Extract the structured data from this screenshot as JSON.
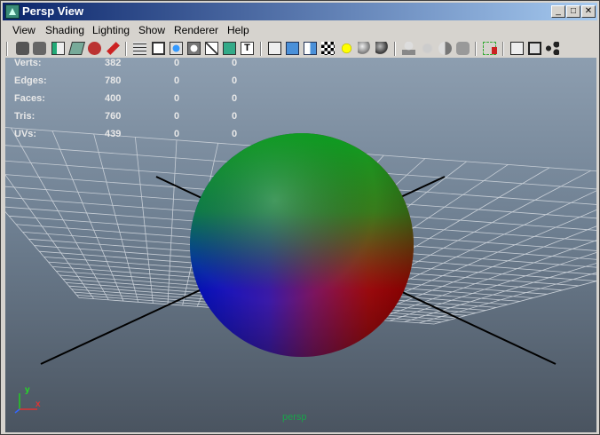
{
  "window": {
    "title": "Persp View",
    "min_glyph": "_",
    "max_glyph": "□",
    "close_glyph": "✕"
  },
  "menu": {
    "items": [
      "View",
      "Shading",
      "Lighting",
      "Show",
      "Renderer",
      "Help"
    ]
  },
  "toolbar": {
    "icons": [
      "camera-icon",
      "camera-attributes-icon",
      "bookmark-icon",
      "image-plane-icon",
      "isolate-icon",
      "pencil-icon",
      "grid-icon",
      "film-gate-icon",
      "resolution-gate-icon",
      "gate-mask-icon",
      "field-chart-icon",
      "safe-action-icon",
      "safe-title-icon",
      "wireframe-cube-icon",
      "smooth-shade-cube-icon",
      "flat-shade-cube-icon",
      "checker-icon",
      "default-light-icon",
      "all-lights-icon",
      "shadow-icon",
      "xray-joints-icon",
      "xray-icon",
      "backface-icon",
      "smooth-preview-icon",
      "high-quality-icon",
      "select-camera-icon",
      "frame-all-icon",
      "isolate-select-icon",
      "hypergraph-icon"
    ]
  },
  "hud": {
    "rows": [
      {
        "label": "Verts:",
        "values": [
          "382",
          "0",
          "0"
        ]
      },
      {
        "label": "Edges:",
        "values": [
          "780",
          "0",
          "0"
        ]
      },
      {
        "label": "Faces:",
        "values": [
          "400",
          "0",
          "0"
        ]
      },
      {
        "label": "Tris:",
        "values": [
          "760",
          "0",
          "0"
        ]
      },
      {
        "label": "UVs:",
        "values": [
          "439",
          "0",
          "0"
        ]
      }
    ]
  },
  "axis": {
    "x": "x",
    "y": "y"
  },
  "camera": {
    "name": "persp"
  },
  "colors": {
    "title_start": "#0a246a",
    "title_end": "#a6caf0",
    "hud_text": "#e8e8e8",
    "camera_label": "#1aa34a",
    "grid": "#bfc7cf"
  }
}
